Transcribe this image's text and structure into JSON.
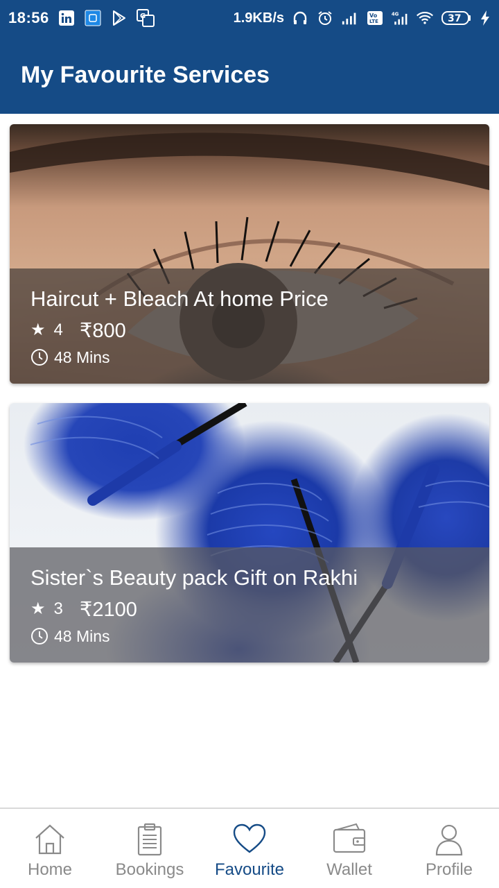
{
  "status_bar": {
    "time": "18:56",
    "net_speed": "1.9KB/s",
    "battery": "37",
    "left_icons": [
      "linkedin-icon",
      "mi-icon",
      "play-store-icon",
      "translate-icon"
    ],
    "right_icons": [
      "headphones-icon",
      "alarm-icon",
      "signal-icon",
      "volte-icon",
      "4g-signal-icon",
      "wifi-icon",
      "battery-icon",
      "charging-icon"
    ]
  },
  "header": {
    "title": "My Favourite Services"
  },
  "services": [
    {
      "title": "Haircut + Bleach At home Price",
      "rating": "4",
      "price": "₹800",
      "duration": "48 Mins",
      "image": "eye-closeup-photo"
    },
    {
      "title": "Sister`s Beauty pack Gift on Rakhi",
      "rating": "3",
      "price": "₹2100",
      "duration": "48 Mins",
      "image": "blue-mascara-photo"
    }
  ],
  "bottom_nav": {
    "items": [
      {
        "label": "Home",
        "icon": "home-icon"
      },
      {
        "label": "Bookings",
        "icon": "clipboard-icon"
      },
      {
        "label": "Favourite",
        "icon": "heart-icon"
      },
      {
        "label": "Wallet",
        "icon": "wallet-icon"
      },
      {
        "label": "Profile",
        "icon": "user-icon"
      }
    ],
    "active": "Favourite"
  },
  "colors": {
    "primary": "#154b86",
    "inactive": "#8a8a8a"
  }
}
